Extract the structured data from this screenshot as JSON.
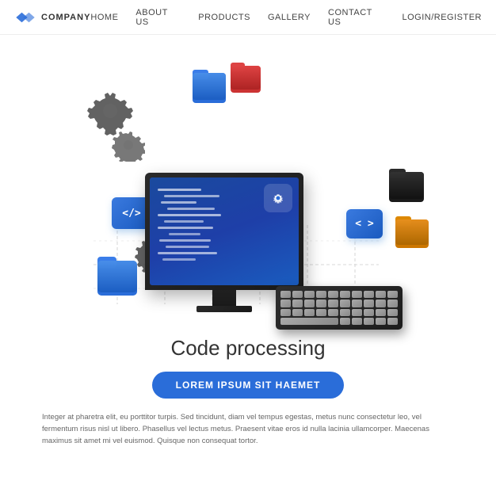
{
  "nav": {
    "logo_text": "COMPANY",
    "links": [
      {
        "label": "HOME",
        "id": "home"
      },
      {
        "label": "ABOUT US",
        "id": "about"
      },
      {
        "label": "PRODUCTS",
        "id": "products"
      },
      {
        "label": "GALLERY",
        "id": "gallery"
      },
      {
        "label": "CONTACT US",
        "id": "contact"
      },
      {
        "label": "LOGIN/REGISTER",
        "id": "login"
      }
    ]
  },
  "hero": {
    "title": "Code processing",
    "cta_label": "LOREM IPSUM SIT HAEMET",
    "description": "Integer at pharetra elit, eu porttitor turpis. Sed tincidunt, diam vel tempus egestas, metus nunc consectetur leo, vel fermentum risus nisl ut libero. Phasellus vel lectus metus. Praesent vitae eros id nulla lacinia ullamcorper. Maecenas maximus sit amet mi vel euismod. Quisque non consequat tortor."
  },
  "colors": {
    "blue": "#2a6dd9",
    "dark_blue": "#1a4a9e",
    "red": "#e04040",
    "yellow_orange": "#e8a020",
    "dark": "#1a1a1a",
    "gear_dark": "#2a2a2a"
  }
}
